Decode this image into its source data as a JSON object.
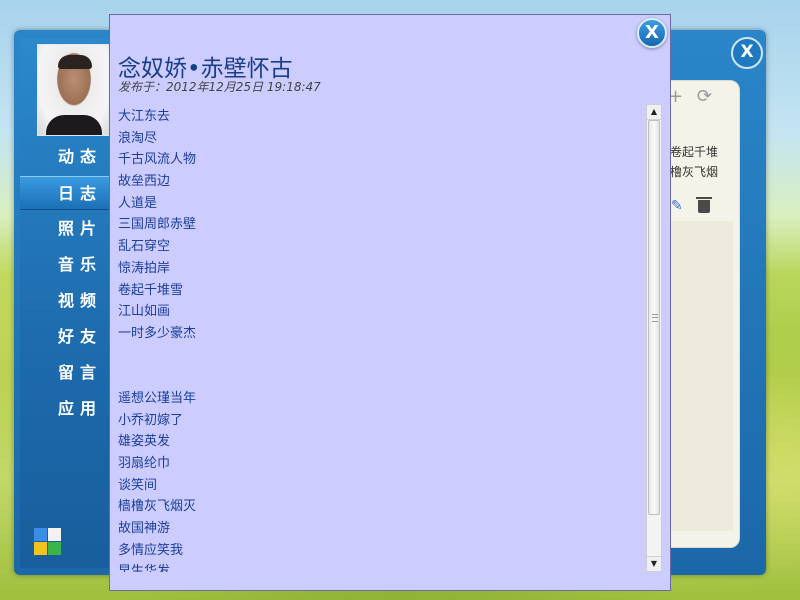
{
  "sidebar": {
    "items": [
      {
        "label": "动态",
        "active": false
      },
      {
        "label": "日志",
        "active": true
      },
      {
        "label": "照片",
        "active": false
      },
      {
        "label": "音乐",
        "active": false
      },
      {
        "label": "视频",
        "active": false
      },
      {
        "label": "好友",
        "active": false
      },
      {
        "label": "留言",
        "active": false
      },
      {
        "label": "应用",
        "active": false
      }
    ]
  },
  "back_window": {
    "close_label": "X",
    "preview_line1": "卷起千堆",
    "preview_line2": "橹灰飞烟"
  },
  "article": {
    "title": "念奴娇•赤壁怀古",
    "meta": "发布于：2012年12月25日 19:18:47",
    "lines": [
      "大江东去",
      "浪淘尽",
      "千古风流人物",
      "故垒西边",
      "人道是",
      "三国周郎赤壁",
      "乱石穿空",
      "惊涛拍岸",
      "卷起千堆雪",
      "江山如画",
      "一时多少豪杰",
      "",
      "",
      "遥想公瑾当年",
      "小乔初嫁了",
      "雄姿英发",
      "羽扇纶巾",
      "谈笑间",
      "樯橹灰飞烟灭",
      "故国神游",
      "多情应笑我",
      "早生华发"
    ]
  },
  "modal": {
    "close_label": "X"
  },
  "colors": {
    "modal_background": "#ccccff",
    "text_blue": "#1c3f9a",
    "accent": "#1e73b9"
  }
}
